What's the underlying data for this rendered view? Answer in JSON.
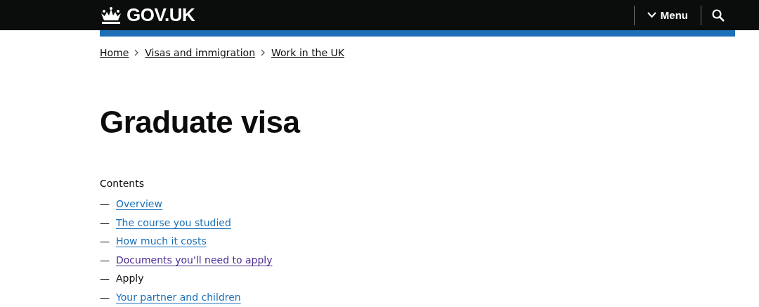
{
  "header": {
    "logo": "GOV.UK",
    "menu_button": "Menu"
  },
  "breadcrumbs": [
    "Home",
    "Visas and immigration",
    "Work in the UK"
  ],
  "title": "Graduate visa",
  "contents": {
    "heading": "Contents",
    "items": [
      {
        "dash": "—",
        "label": "Overview",
        "selected": false,
        "visited": false
      },
      {
        "dash": "—",
        "label": "The course you studied",
        "selected": false,
        "visited": false
      },
      {
        "dash": "—",
        "label": "How much it costs",
        "selected": false,
        "visited": false
      },
      {
        "dash": "—",
        "label": "Documents you'll need to apply",
        "selected": false,
        "visited": true
      },
      {
        "dash": "—",
        "label": "Apply",
        "selected": true,
        "visited": false
      },
      {
        "dash": "—",
        "label": "Your partner and children",
        "selected": false,
        "visited": false
      }
    ]
  }
}
